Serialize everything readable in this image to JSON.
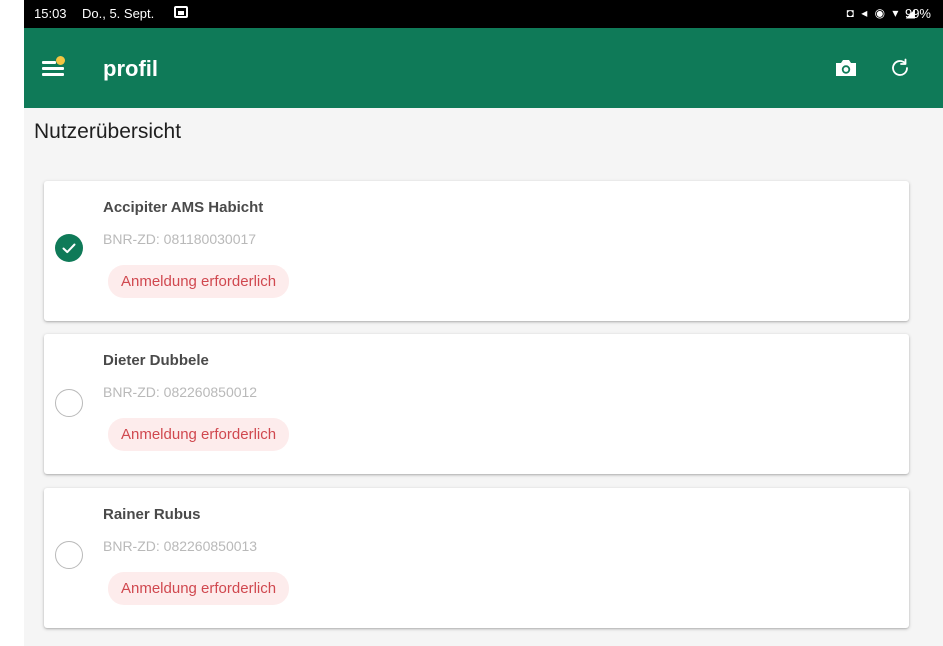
{
  "statusbar": {
    "time": "15:03",
    "date": "Do., 5. Sept.",
    "right_icons": "◘ ◂ ◉ ▾ ◢",
    "battery": "99%"
  },
  "appbar": {
    "title": "profil",
    "background_color": "#0f7a58",
    "menu_icon": "menu-icon",
    "actions": [
      "camera-icon",
      "refresh-icon"
    ]
  },
  "page": {
    "title": "Nutzerübersicht"
  },
  "users": [
    {
      "name": "Accipiter AMS Habicht",
      "bnr": "BNR-ZD: 081180030017",
      "status": "Anmeldung erforderlich",
      "selected": true
    },
    {
      "name": "Dieter Dubbele",
      "bnr": "BNR-ZD: 082260850012",
      "status": "Anmeldung erforderlich",
      "selected": false
    },
    {
      "name": "Rainer Rubus",
      "bnr": "BNR-ZD: 082260850013",
      "status": "Anmeldung erforderlich",
      "selected": false
    }
  ],
  "colors": {
    "accent": "#0f7a58",
    "badge_bg": "#fdecec",
    "badge_text": "#d0484f"
  }
}
